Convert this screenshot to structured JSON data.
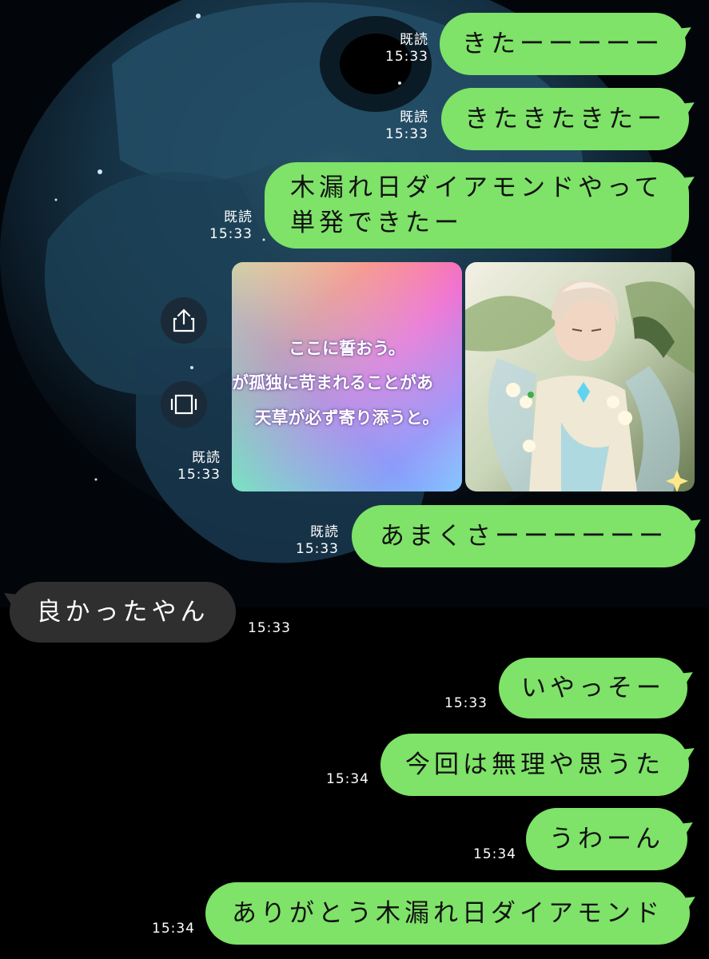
{
  "messages": [
    {
      "id": "m1",
      "side": "mine",
      "text": "きたーーーーー",
      "read": "既読",
      "time": "15:33"
    },
    {
      "id": "m2",
      "side": "mine",
      "text": "きたきたきたー",
      "read": "既読",
      "time": "15:33"
    },
    {
      "id": "m3",
      "side": "mine",
      "lines": [
        "木漏れ日ダイアモンドやって",
        "単発できたー"
      ],
      "read": "既読",
      "time": "15:33"
    },
    {
      "id": "m4",
      "side": "mine",
      "type": "images",
      "read": "既読",
      "time": "15:33",
      "card_text": [
        "ここに誓おう。",
        "が孤独に苛まれることがあ",
        "天草が必ず寄り添うと。"
      ]
    },
    {
      "id": "m5",
      "side": "mine",
      "text": "あまくさーーーーーー",
      "read": "既読",
      "time": "15:33"
    },
    {
      "id": "m6",
      "side": "theirs",
      "text": "良かったやん",
      "time": "15:33"
    },
    {
      "id": "m7",
      "side": "mine",
      "text": "いやっそー",
      "time": "15:33"
    },
    {
      "id": "m8",
      "side": "mine",
      "text": "今回は無理や思うた",
      "time": "15:34"
    },
    {
      "id": "m9",
      "side": "mine",
      "text": "うわーん",
      "time": "15:34"
    },
    {
      "id": "m10",
      "side": "mine",
      "text": "ありがとう木漏れ日ダイアモンド",
      "time": "15:34"
    }
  ],
  "actions": {
    "share_icon": "share-icon",
    "fullscreen_icon": "fullscreen-icon"
  },
  "colors": {
    "my_bubble": "#7ee368",
    "their_bubble": "#2f2f2f",
    "background": "#000000"
  }
}
